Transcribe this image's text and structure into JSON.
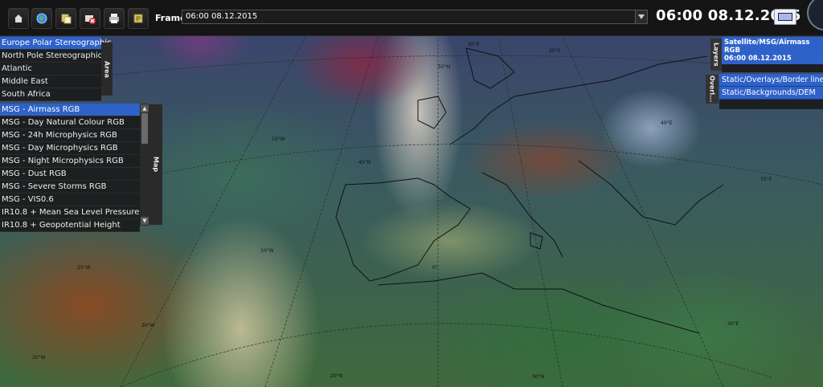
{
  "toolbar": {
    "buttons": [
      {
        "name": "home-view-button",
        "icon": "home-icon"
      },
      {
        "name": "globe-button",
        "icon": "globe-icon"
      },
      {
        "name": "copy-button",
        "icon": "copy-icon"
      },
      {
        "name": "clear-button",
        "icon": "clear-icon"
      },
      {
        "name": "print-button",
        "icon": "printer-icon"
      },
      {
        "name": "legend-button",
        "icon": "legend-icon"
      }
    ],
    "frame_label": "Frame",
    "frame_value": "06:00 08.12.2015",
    "time_display": "06:00 08.12.2015"
  },
  "area": {
    "tab_label": "Area",
    "items": [
      {
        "label": "Europe Polar Stereographic",
        "selected": true
      },
      {
        "label": "North Pole Stereographic",
        "selected": false
      },
      {
        "label": "Atlantic",
        "selected": false
      },
      {
        "label": "Middle East",
        "selected": false
      },
      {
        "label": "South Africa",
        "selected": false
      }
    ]
  },
  "map_products": {
    "tab_label": "Map",
    "items": [
      {
        "label": "MSG - Airmass RGB",
        "selected": true
      },
      {
        "label": "MSG - Day Natural Colour RGB",
        "selected": false
      },
      {
        "label": "MSG - 24h Microphysics RGB",
        "selected": false
      },
      {
        "label": "MSG - Day Microphysics RGB",
        "selected": false
      },
      {
        "label": "MSG - Night Microphysics RGB",
        "selected": false
      },
      {
        "label": "MSG - Dust RGB",
        "selected": false
      },
      {
        "label": "MSG - Severe Storms RGB",
        "selected": false
      },
      {
        "label": "MSG - VIS0.6",
        "selected": false
      },
      {
        "label": "IR10.8 + Mean Sea Level Pressure",
        "selected": false
      },
      {
        "label": "IR10.8 + Geopotential Height",
        "selected": false
      }
    ]
  },
  "layers": {
    "tab_label": "Layers",
    "title": "Satellite/MSG/Airmass RGB",
    "time": "06:00 08.12.2015"
  },
  "overlays": {
    "tab_label": "Overl...",
    "items": [
      "Static/Overlays/Border lines",
      "Static/Backgrounds/DEM"
    ]
  },
  "map_labels": [
    "45°N",
    "20°N",
    "30°N",
    "10°E",
    "10°W",
    "0°",
    "50°N",
    "20°E",
    "35°E",
    "30°E",
    "40°E",
    "25°W",
    "15°W",
    "30°W",
    "20°W"
  ],
  "colors": {
    "selection": "#2e62c9",
    "panel_bg": "#191919",
    "toolbar_bg": "#151515"
  }
}
